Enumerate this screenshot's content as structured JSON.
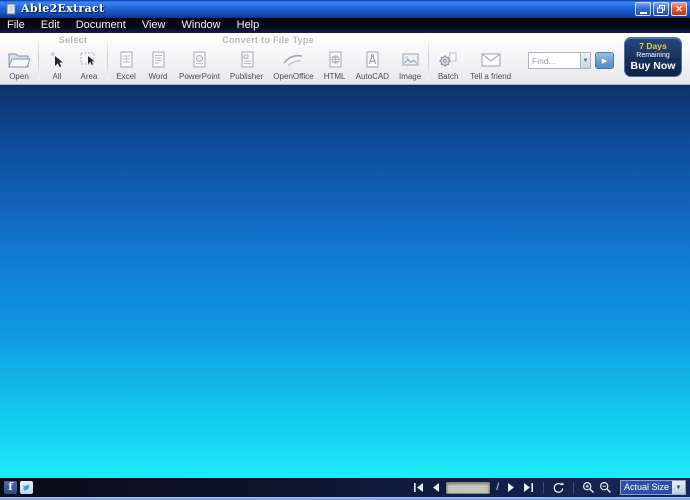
{
  "window": {
    "title": "Able2Extract",
    "controls": {
      "minimize": "minimize",
      "restore": "restore",
      "close": "close"
    }
  },
  "menu": {
    "items": [
      {
        "label": "File"
      },
      {
        "label": "Edit"
      },
      {
        "label": "Document"
      },
      {
        "label": "View"
      },
      {
        "label": "Window"
      },
      {
        "label": "Help"
      }
    ]
  },
  "toolbar": {
    "select_label": "Select",
    "convert_label": "Convert to File Type",
    "tools": [
      {
        "label": "Open",
        "icon": "open-folder-icon"
      },
      {
        "label": "All",
        "icon": "select-all-icon"
      },
      {
        "label": "Area",
        "icon": "select-area-icon"
      },
      {
        "label": "Excel",
        "icon": "excel-doc-icon"
      },
      {
        "label": "Word",
        "icon": "word-doc-icon"
      },
      {
        "label": "PowerPoint",
        "icon": "powerpoint-doc-icon"
      },
      {
        "label": "Publisher",
        "icon": "publisher-doc-icon"
      },
      {
        "label": "OpenOffice",
        "icon": "openoffice-icon"
      },
      {
        "label": "HTML",
        "icon": "html-doc-icon"
      },
      {
        "label": "AutoCAD",
        "icon": "autocad-doc-icon"
      },
      {
        "label": "Image",
        "icon": "image-icon"
      },
      {
        "label": "Batch",
        "icon": "batch-gear-icon"
      },
      {
        "label": "Tell a friend",
        "icon": "envelope-icon"
      }
    ]
  },
  "find": {
    "placeholder": "Find..."
  },
  "trial": {
    "days": "7 Days",
    "remaining": "Remaining",
    "buy": "Buy Now"
  },
  "statusbar": {
    "page_separator": "/",
    "zoom_select": "Actual Size",
    "icons": [
      "facebook-icon",
      "twitter-icon",
      "first-page-icon",
      "prev-page-icon",
      "next-page-icon",
      "last-page-icon",
      "rotate-icon",
      "zoom-in-icon",
      "zoom-out-icon"
    ]
  },
  "colors": {
    "titlebar_blue": "#2063dc",
    "doc_gradient_top": "#0d3268",
    "doc_gradient_bottom": "#1cecf8",
    "trial_button": "#16305e",
    "trial_days_text": "#f2cb3e",
    "statusbar_navy": "#15295a"
  }
}
